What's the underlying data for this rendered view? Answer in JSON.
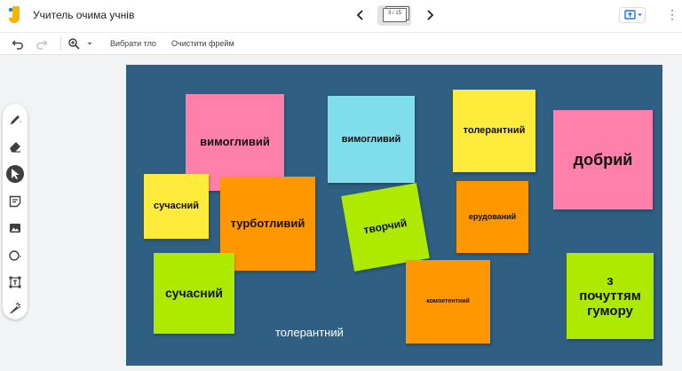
{
  "header": {
    "title": "Учитель очима учнів",
    "frame_counter": "3 / 15"
  },
  "toolbar": {
    "set_background": "Вибрати тло",
    "clear_frame": "Очистити фрейм"
  },
  "notes": [
    {
      "text": "вимогливий",
      "color": "#ff80ab"
    },
    {
      "text": "вимогливий",
      "color": "#80deea"
    },
    {
      "text": "толерантний",
      "color": "#ffeb3b"
    },
    {
      "text": "добрий",
      "color": "#ff80ab"
    },
    {
      "text": "сучасний",
      "color": "#ffeb3b"
    },
    {
      "text": "турботливий",
      "color": "#ff9800"
    },
    {
      "text": "творчий",
      "color": "#aeea00"
    },
    {
      "text": "ерудований",
      "color": "#ff9800"
    },
    {
      "text": "сучасний",
      "color": "#aeea00"
    },
    {
      "text": "компетентний",
      "color": "#ff9800"
    },
    {
      "text": "з почуттям гумору",
      "color": "#aeea00"
    }
  ],
  "canvas_text": "толерантний",
  "colors": {
    "canvas_background": "#2f5f82",
    "accent": "#1a73e8"
  },
  "icons": {
    "undo": "undo-icon",
    "redo": "redo-icon",
    "zoom": "zoom-icon",
    "pen": "pen-icon",
    "eraser": "eraser-icon",
    "select": "select-icon",
    "sticky_note": "sticky-note-icon",
    "image": "image-icon",
    "circle": "circle-icon",
    "text_box": "text-box-icon",
    "laser": "laser-icon"
  }
}
